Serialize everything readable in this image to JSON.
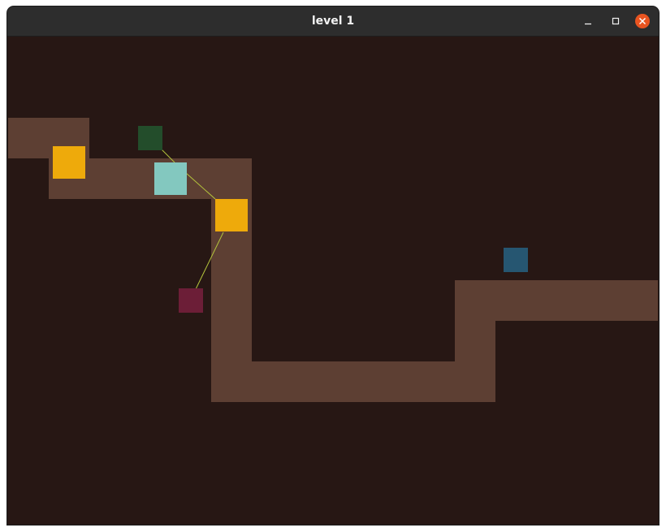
{
  "window": {
    "title": "level 1"
  },
  "controls": {
    "minimize_icon": "minimize-icon",
    "maximize_icon": "maximize-icon",
    "close_icon": "close-icon"
  },
  "colors": {
    "background": "#271714",
    "path": "#5d3f33",
    "titlebar": "#2d2d2d",
    "link": "#b4c43c",
    "gold_block": "#eeaa0b",
    "teal_block": "#83c8bf",
    "green_block": "#234d2b",
    "maroon_block": "#6c1e37",
    "blue_block": "#265671",
    "close_button": "#e95420"
  }
}
